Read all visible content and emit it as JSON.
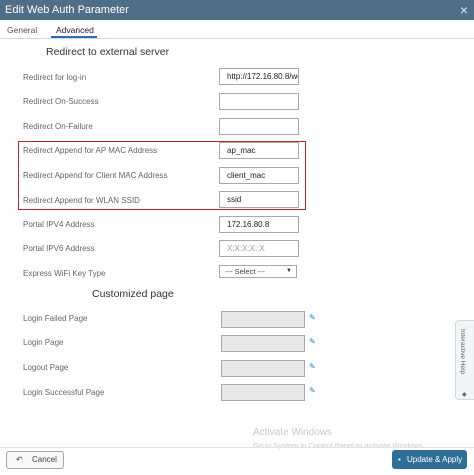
{
  "window": {
    "title": "Edit Web Auth Parameter",
    "close_glyph": "×"
  },
  "tabs": [
    {
      "label": "General",
      "active": false
    },
    {
      "label": "Advanced",
      "active": true
    }
  ],
  "sections": {
    "redirect": "Redirect to external server",
    "customized": "Customized page"
  },
  "redirect_fields": [
    {
      "label": "Redirect for log-in",
      "value": "http://172.16.80.8/we"
    },
    {
      "label": "Redirect On-Success",
      "value": ""
    },
    {
      "label": "Redirect On-Failure",
      "value": ""
    },
    {
      "label": "Redirect Append for AP MAC Address",
      "value": "ap_mac"
    },
    {
      "label": "Redirect Append for Client MAC Address",
      "value": "client_mac"
    },
    {
      "label": "Redirect Append for WLAN SSID",
      "value": "ssid"
    },
    {
      "label": "Portal IPV4 Address",
      "value": "172.16.80.8"
    },
    {
      "label": "Portal IPV6 Address",
      "placeholder": "X:X:X:X::X"
    }
  ],
  "express_wifi": {
    "label": "Express WiFi Key Type",
    "selected": "--- Select ---"
  },
  "custom_pages": [
    {
      "label": "Login Failed Page"
    },
    {
      "label": "Login Page"
    },
    {
      "label": "Logout Page"
    },
    {
      "label": "Login Successful Page"
    }
  ],
  "side_panel": {
    "label": "Interactive Help"
  },
  "watermark": {
    "line1": "Activate Windows",
    "line2": "Go to System in Control Panel to activate Windows."
  },
  "footer": {
    "cancel_label": "Cancel",
    "apply_label": "Update & Apply"
  },
  "icons": {
    "edit": "edit-icon",
    "cancel": "undo-icon",
    "apply": "save-icon"
  },
  "colors": {
    "titlebar": "#4f6f86",
    "highlight_box": "#c0262d",
    "primary_button": "#2f6e97",
    "tab_underline": "#2a6fb5"
  }
}
